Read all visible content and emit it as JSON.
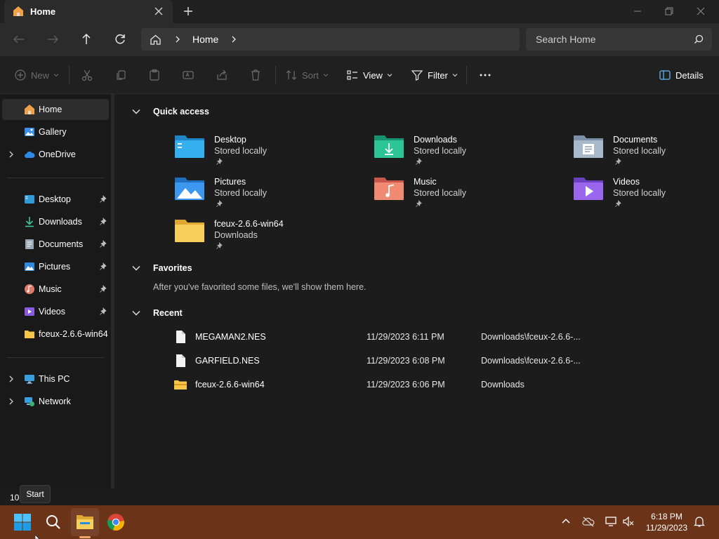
{
  "window": {
    "tab_title": "Home",
    "colors": {
      "accent_taskbar": "#6b3318",
      "background": "#1c1c1c",
      "folder_yellow": "#f6c648"
    }
  },
  "address": {
    "breadcrumb": "Home",
    "search_placeholder": "Search Home"
  },
  "commands": {
    "new": "New",
    "sort": "Sort",
    "view": "View",
    "filter": "Filter",
    "details": "Details"
  },
  "sidebar": {
    "items": [
      {
        "label": "Home",
        "icon": "home-icon"
      },
      {
        "label": "Gallery",
        "icon": "gallery-icon"
      },
      {
        "label": "OneDrive",
        "icon": "cloud-icon"
      }
    ],
    "pinned": [
      {
        "label": "Desktop",
        "icon": "desktop-icon"
      },
      {
        "label": "Downloads",
        "icon": "download-icon"
      },
      {
        "label": "Documents",
        "icon": "document-icon"
      },
      {
        "label": "Pictures",
        "icon": "pictures-icon"
      },
      {
        "label": "Music",
        "icon": "music-icon"
      },
      {
        "label": "Videos",
        "icon": "video-icon"
      },
      {
        "label": "fceux-2.6.6-win64",
        "icon": "folder-icon"
      }
    ],
    "bottom": [
      {
        "label": "This PC",
        "icon": "pc-icon"
      },
      {
        "label": "Network",
        "icon": "network-icon"
      }
    ]
  },
  "main": {
    "quick_access_title": "Quick access",
    "quick_access": [
      {
        "name": "Desktop",
        "sub": "Stored locally"
      },
      {
        "name": "Downloads",
        "sub": "Stored locally"
      },
      {
        "name": "Documents",
        "sub": "Stored locally"
      },
      {
        "name": "Pictures",
        "sub": "Stored locally"
      },
      {
        "name": "Music",
        "sub": "Stored locally"
      },
      {
        "name": "Videos",
        "sub": "Stored locally"
      },
      {
        "name": "fceux-2.6.6-win64",
        "sub": "Downloads"
      }
    ],
    "favorites_title": "Favorites",
    "favorites_empty": "After you've favorited some files, we'll show them here.",
    "recent_title": "Recent",
    "recent": [
      {
        "name": "MEGAMAN2.NES",
        "date": "11/29/2023 6:11 PM",
        "path": "Downloads\\fceux-2.6.6-..."
      },
      {
        "name": "GARFIELD.NES",
        "date": "11/29/2023 6:08 PM",
        "path": "Downloads\\fceux-2.6.6-..."
      },
      {
        "name": "fceux-2.6.6-win64",
        "date": "11/29/2023 6:06 PM",
        "path": "Downloads"
      }
    ]
  },
  "status": {
    "item_count": "10",
    "tooltip": "Start"
  },
  "taskbar": {
    "time": "6:18 PM",
    "date": "11/29/2023"
  }
}
